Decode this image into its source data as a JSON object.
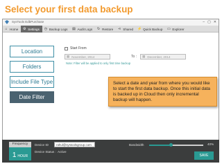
{
  "headline": "Select your first data backup",
  "window": {
    "title": "SysTools EdbPurchase"
  },
  "tabs": [
    {
      "label": "Home",
      "icon": "home-icon",
      "glyph": "⌂"
    },
    {
      "label": "Settings",
      "icon": "gear-icon",
      "glyph": "⚙"
    },
    {
      "label": "Backup Logs",
      "icon": "clock-icon",
      "glyph": "◷"
    },
    {
      "label": "Audit Logs",
      "icon": "document-icon",
      "glyph": "▤"
    },
    {
      "label": "Restore",
      "icon": "restore-icon",
      "glyph": "↻"
    },
    {
      "label": "Shared",
      "icon": "share-icon",
      "glyph": "⋖"
    },
    {
      "label": "Quick Backup",
      "icon": "bolt-icon",
      "glyph": "⚡"
    },
    {
      "label": "Explorer",
      "icon": "folder-icon",
      "glyph": "▭"
    }
  ],
  "active_tab": "Settings",
  "sidebar": [
    {
      "label": "Location",
      "active": false
    },
    {
      "label": "Folders",
      "active": false
    },
    {
      "label": "Include File Type",
      "active": false
    },
    {
      "label": "Date Filter",
      "active": true
    }
  ],
  "date_filter": {
    "start_label": "Start From",
    "from_value": "November, 2014",
    "to_label": "To :",
    "to_value": "December, 2014",
    "note": "Note:  Filter will be applied to only first time backup"
  },
  "callout": "Select a date and year from where you would like to start the first data backup. Once this initial data is backed up in Cloud then only incremental backup will happen.",
  "bottom": {
    "frequency_label": "Frequency",
    "frequency_value": "1",
    "frequency_unit": "HOUR",
    "device_id_label": "Device ID",
    "device_id_value": "rahul@systoolsgroup.com",
    "device_status_label": "Device Status :",
    "device_status_value": "Active",
    "bandwidth_label": "Bandwidth",
    "bandwidth_percent": 40,
    "bandwidth_text": "40%",
    "save_label": "SAVE"
  },
  "colors": {
    "accent": "#f29a2e",
    "teal": "#2a9a93",
    "callout": "#f6b25c"
  }
}
